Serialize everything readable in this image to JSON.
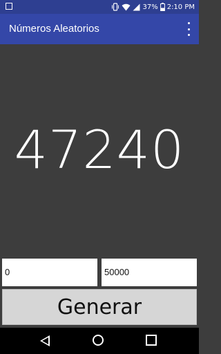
{
  "status_bar": {
    "battery": "37%",
    "time": "2:10 PM",
    "icons": [
      "notification-square-icon",
      "vibrate-icon",
      "wifi-icon",
      "signal-icon",
      "battery-icon"
    ]
  },
  "app_bar": {
    "title": "Números Aleatorios",
    "menu_icon": "overflow-menu-icon"
  },
  "main": {
    "result": "47240"
  },
  "inputs": {
    "min_value": "0",
    "max_value": "50000"
  },
  "button": {
    "label": "Generar"
  },
  "nav_bar": {
    "icons": [
      "back-icon",
      "home-icon",
      "recents-icon"
    ]
  },
  "colors": {
    "status_bar": "#2e3f91",
    "app_bar": "#3447a8",
    "background": "#3d3d3d",
    "button": "#d6d6d6"
  }
}
